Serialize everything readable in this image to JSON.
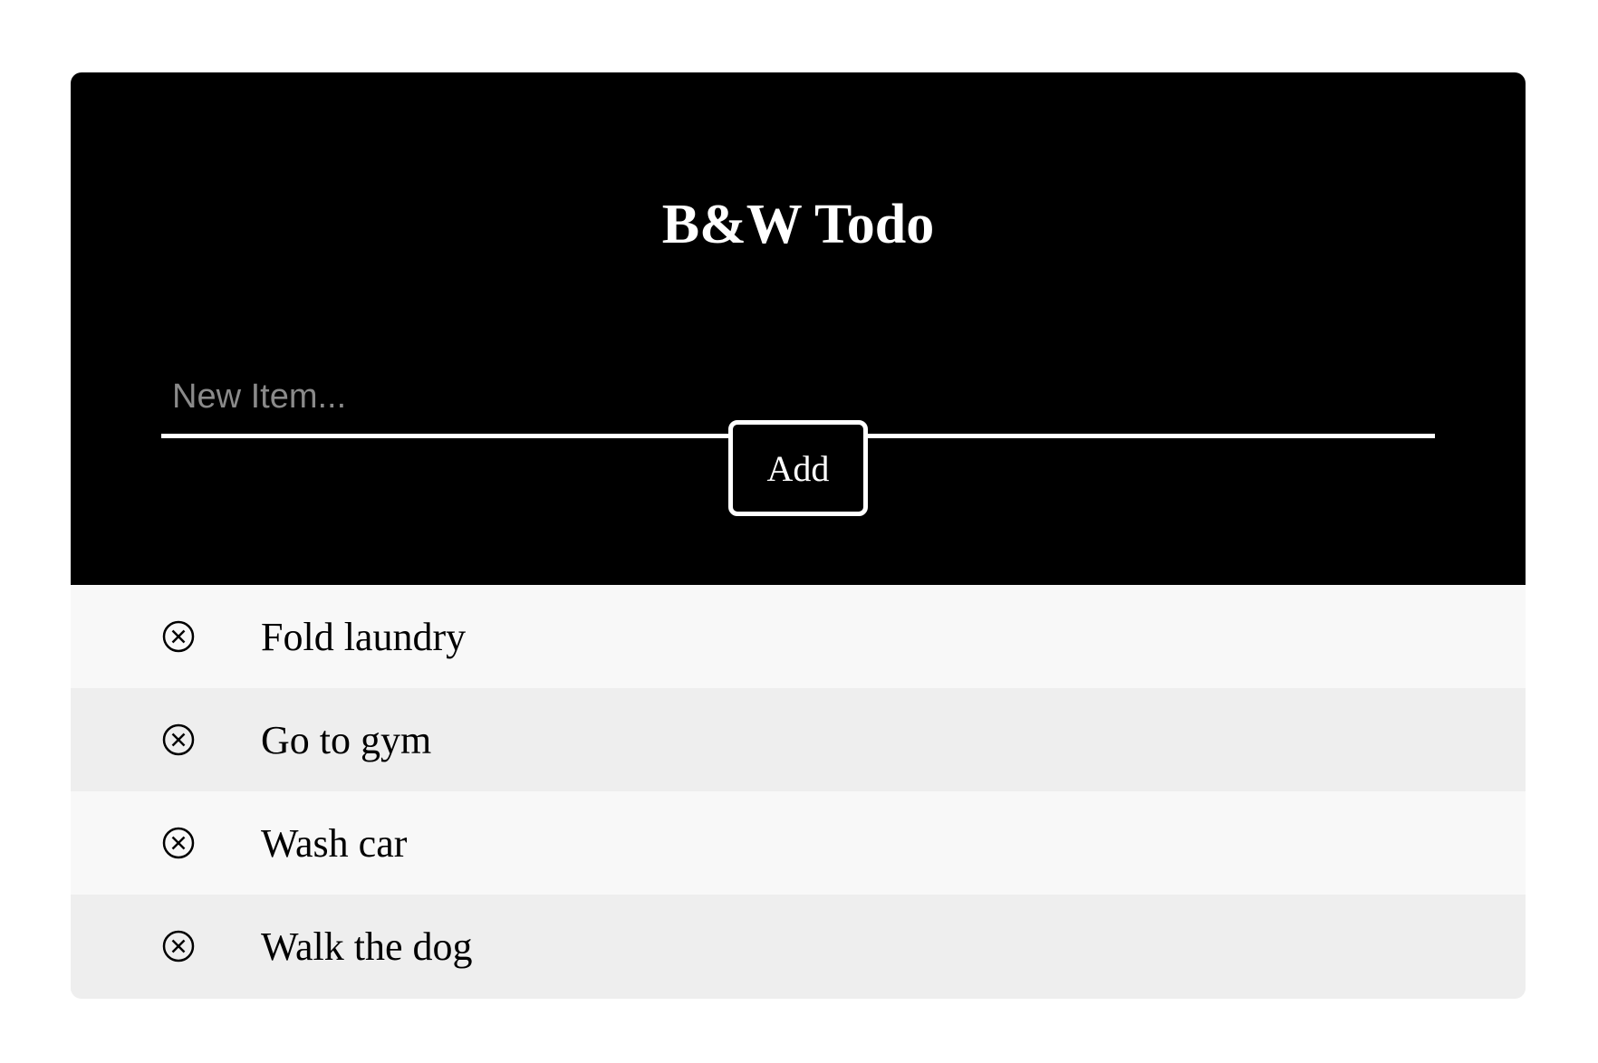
{
  "app": {
    "title": "B&W Todo"
  },
  "new_item": {
    "placeholder": "New Item...",
    "value": ""
  },
  "add_button": {
    "label": "Add"
  },
  "todo_items": [
    {
      "label": "Fold laundry",
      "remove_icon": "circle-x-icon"
    },
    {
      "label": "Go to gym",
      "remove_icon": "circle-x-icon"
    },
    {
      "label": "Wash car",
      "remove_icon": "circle-x-icon"
    },
    {
      "label": "Walk the dog",
      "remove_icon": "circle-x-icon"
    }
  ],
  "colors": {
    "header_background": "#000000",
    "header_text": "#ffffff",
    "row_light": "#f8f8f8",
    "row_dark": "#eeeeee",
    "placeholder": "#8a8a8a"
  }
}
